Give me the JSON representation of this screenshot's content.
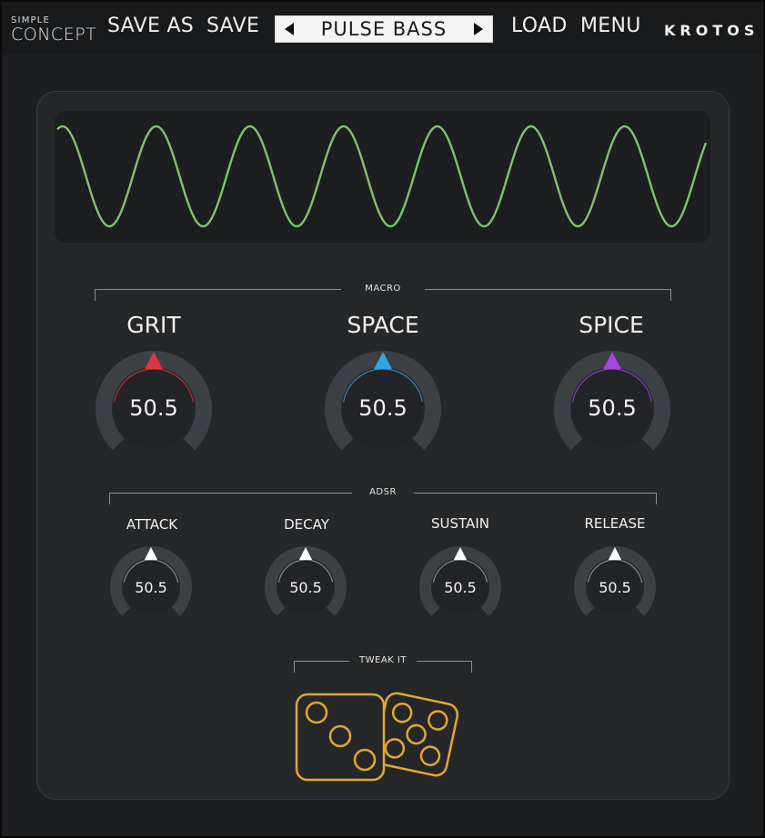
{
  "header": {
    "logo_top": "SIMPLE",
    "logo_bottom": "CONCEPT",
    "save_as_label": "SAVE AS",
    "save_label": "SAVE",
    "preset_name": "PULSE BASS",
    "load_label": "LOAD",
    "menu_label": "MENU",
    "brand": "KROTOS"
  },
  "colors": {
    "waveform": "#7fc36b",
    "grit": "#e0343e",
    "space": "#2fa6e0",
    "spice": "#a545e0",
    "dice": "#e0a832"
  },
  "macro": {
    "title": "MACRO",
    "knobs": [
      {
        "label": "GRIT",
        "value": "50.5"
      },
      {
        "label": "SPACE",
        "value": "50.5"
      },
      {
        "label": "SPICE",
        "value": "50.5"
      }
    ]
  },
  "adsr": {
    "title": "ADSR",
    "knobs": [
      {
        "label": "ATTACK",
        "value": "50.5"
      },
      {
        "label": "DECAY",
        "value": "50.5"
      },
      {
        "label": "SUSTAIN",
        "value": "50.5"
      },
      {
        "label": "RELEASE",
        "value": "50.5"
      }
    ]
  },
  "tweak": {
    "title": "TWEAK IT"
  }
}
